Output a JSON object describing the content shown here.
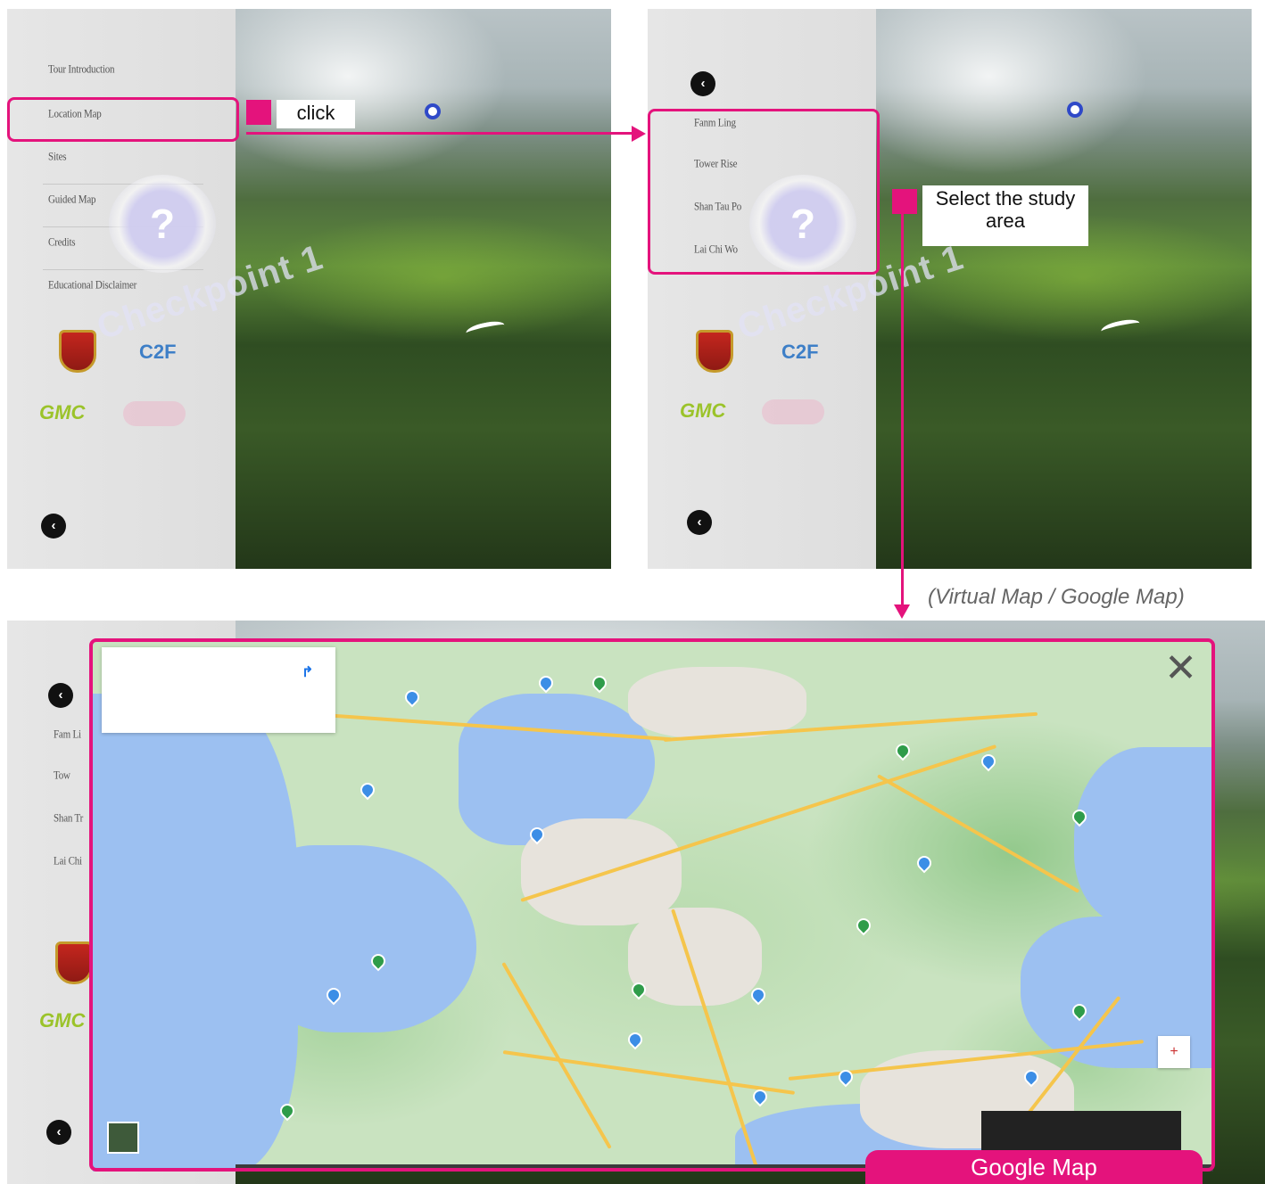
{
  "panel1": {
    "menu_items": [
      "Tour Introduction",
      "Location Map",
      "Sites",
      "Guided Map",
      "Credits",
      "Educational Disclaimer"
    ],
    "checkpoint_text": "Checkpoint 1",
    "help_glyph": "?",
    "back_glyph": "‹"
  },
  "panel2": {
    "menu_items": [
      "Fanm Ling",
      "Tower Rise",
      "Shan Tau Po",
      "Lai Chi Wo"
    ],
    "checkpoint_text": "Checkpoint 1",
    "help_glyph": "?",
    "back_glyph": "‹"
  },
  "panel3": {
    "menu_items": [
      "Fam Li",
      "Tow",
      "Shan Tr",
      "Lai Chi"
    ],
    "back_glyph": "‹"
  },
  "logos": {
    "c2f": "C2F",
    "gmc": "GMC"
  },
  "annotations": {
    "click": "click",
    "select_study_area": "Select the study area",
    "caption": "(Virtual Map / Google Map)",
    "google_map_label": "Google Map"
  },
  "map": {
    "close_glyph": "✕",
    "zoom_glyph": "+",
    "direction_glyph": "↱"
  },
  "colors": {
    "accent": "#e4137c",
    "water": "#9cc0f1",
    "land": "#c9e3c0",
    "road": "#f5c54c"
  }
}
